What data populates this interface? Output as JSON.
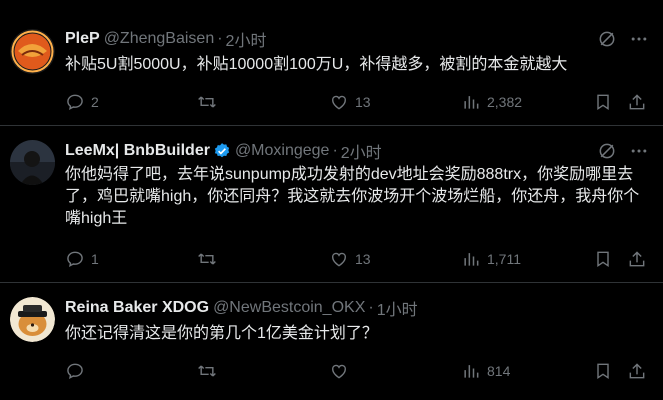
{
  "tweets": [
    {
      "name": "PleP",
      "handle": "@ZhengBaisen",
      "sep": "·",
      "time": "2小时",
      "text": "补贴5U割5000U，补贴10000割100万U，补得越多，被割的本金就越大",
      "replies": "2",
      "reposts": "",
      "likes": "13",
      "views": "2,382",
      "avatar_color": "#c8501e"
    },
    {
      "name": "LeeMx| BnbBuilder",
      "handle": "@Moxingege",
      "sep": "·",
      "time": "2小时",
      "text": "你他妈得了吧，去年说sunpump成功发射的dev地址会奖励888trx，你奖励哪里去了，鸡巴就嘴high，你还同舟？我这就去你波场开个波场烂船，你还舟，我舟你个嘴high王",
      "replies": "1",
      "reposts": "",
      "likes": "13",
      "views": "1,711",
      "avatar_color": "#3d4a5a"
    },
    {
      "name": "Reina Baker XDOG",
      "handle": "@NewBestcoin_OKX",
      "sep": "·",
      "time": "1小时",
      "text": "你还记得清这是你的第几个1亿美金计划了？",
      "replies": "",
      "reposts": "",
      "likes": "",
      "views": "814",
      "avatar_color": "#d89a3a"
    }
  ],
  "colors": {
    "background": "#000000",
    "text": "#e7e9ea",
    "muted": "#71767b",
    "border": "#2f3336",
    "verified": "#1d9bf0"
  },
  "icons": [
    "reply-icon",
    "repost-icon",
    "like-icon",
    "views-icon",
    "bookmark-icon",
    "share-icon",
    "grok-icon",
    "more-icon",
    "verified-badge-icon"
  ]
}
